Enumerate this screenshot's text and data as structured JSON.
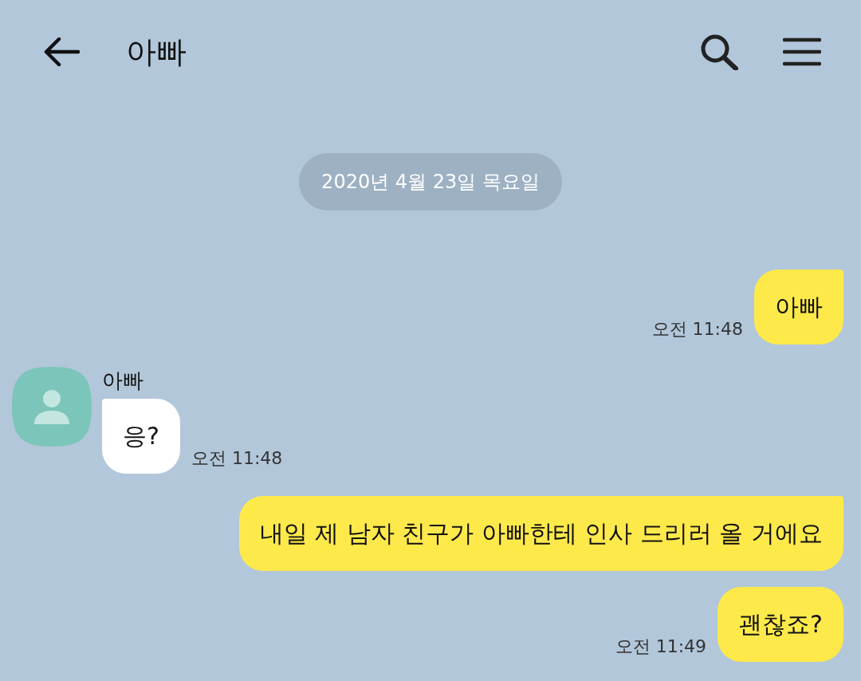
{
  "header": {
    "title": "아빠"
  },
  "date_divider": "2020년 4월 23일 목요일",
  "messages": [
    {
      "kind": "outgoing",
      "text": "아빠",
      "time": "오전 11:48",
      "tail": true
    },
    {
      "kind": "incoming",
      "name": "아빠",
      "text": "응?",
      "time": "오전 11:48",
      "tail": true
    },
    {
      "kind": "outgoing",
      "text": "내일 제 남자 친구가 아빠한테 인사 드리러 올 거에요",
      "tail": true
    },
    {
      "kind": "outgoing",
      "text": "괜찮죠?",
      "time": "오전 11:49",
      "tail": false
    }
  ]
}
